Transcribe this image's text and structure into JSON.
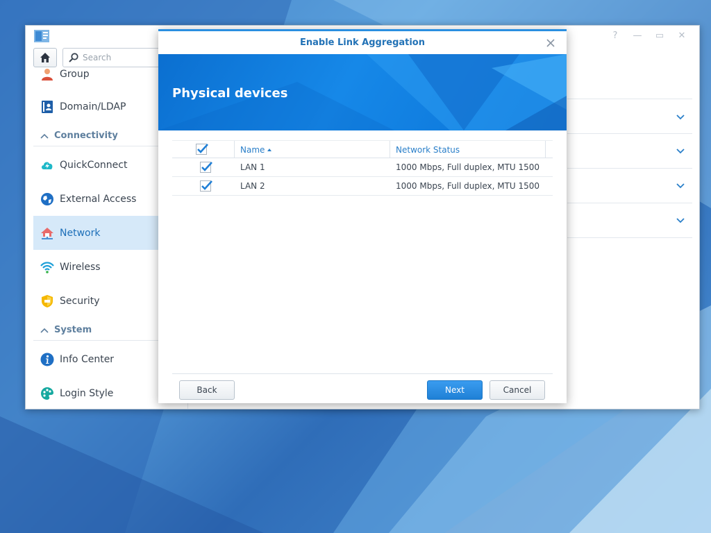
{
  "window": {
    "controls": [
      "?",
      "—",
      "▭",
      "✕"
    ]
  },
  "toolbar": {
    "search_placeholder": "Search"
  },
  "sidebar": {
    "items": [
      {
        "label": "Group",
        "icon": "group-icon"
      },
      {
        "label": "Domain/LDAP",
        "icon": "domain-ldap-icon"
      },
      {
        "label": "QuickConnect",
        "icon": "quickconnect-icon"
      },
      {
        "label": "External Access",
        "icon": "external-access-icon"
      },
      {
        "label": "Network",
        "icon": "network-icon",
        "active": true
      },
      {
        "label": "Wireless",
        "icon": "wireless-icon"
      },
      {
        "label": "Security",
        "icon": "security-icon"
      },
      {
        "label": "Info Center",
        "icon": "info-center-icon"
      },
      {
        "label": "Login Style",
        "icon": "login-style-icon"
      }
    ],
    "sections": {
      "connectivity": "Connectivity",
      "system": "System"
    }
  },
  "dialog": {
    "title": "Enable Link Aggregation",
    "banner_title": "Physical devices",
    "columns": {
      "name": "Name",
      "status": "Network Status"
    },
    "rows": [
      {
        "name": "LAN 1",
        "status": "1000 Mbps, Full duplex, MTU 1500",
        "checked": true
      },
      {
        "name": "LAN 2",
        "status": "1000 Mbps, Full duplex, MTU 1500",
        "checked": true
      }
    ],
    "buttons": {
      "back": "Back",
      "next": "Next",
      "cancel": "Cancel"
    }
  },
  "colors": {
    "accent": "#2a8fe0",
    "active_item_bg": "#d6e9f9",
    "primary_button": "#1f80d6"
  }
}
